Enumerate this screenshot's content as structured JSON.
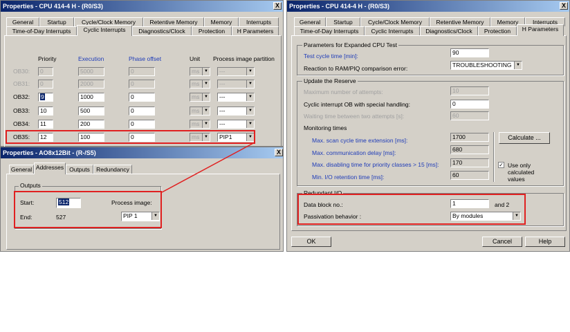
{
  "colors": {
    "highlight": "#e02020",
    "label_blue": "#1f3cb8",
    "titlebar": "#0a246a"
  },
  "left_dialog": {
    "title": "Properties - CPU 414-4 H - (R0/S3)",
    "close": "X",
    "tabs_back": [
      "General",
      "Startup",
      "Cycle/Clock Memory",
      "Retentive Memory",
      "Memory",
      "Interrupts"
    ],
    "tabs_front": [
      "Time-of-Day Interrupts",
      "Cyclic Interrupts",
      "Diagnostics/Clock",
      "Protection",
      "H Parameters"
    ],
    "headers": {
      "priority": "Priority",
      "execution": "Execution",
      "phase": "Phase offset",
      "unit": "Unit",
      "pip": "Process image partition"
    },
    "rows": [
      {
        "ob": "OB30:",
        "priority": "0",
        "execution": "5000",
        "phase": "0",
        "unit": "ms",
        "pip": "---"
      },
      {
        "ob": "OB31:",
        "priority": "0",
        "execution": "2000",
        "phase": "0",
        "unit": "ms",
        "pip": "---"
      },
      {
        "ob": "OB32:",
        "priority": "9",
        "execution": "1000",
        "phase": "0",
        "unit": "ms",
        "pip": "---"
      },
      {
        "ob": "OB33:",
        "priority": "10",
        "execution": "500",
        "phase": "0",
        "unit": "ms",
        "pip": "---"
      },
      {
        "ob": "OB34:",
        "priority": "11",
        "execution": "200",
        "phase": "0",
        "unit": "ms",
        "pip": "---"
      },
      {
        "ob": "OB35:",
        "priority": "12",
        "execution": "100",
        "phase": "0",
        "unit": "ms",
        "pip": "PIP1"
      }
    ]
  },
  "module_dialog": {
    "title": "Properties - AO8x12Bit - (R-/S5)",
    "close": "X",
    "tabs": [
      "General",
      "Addresses",
      "Outputs",
      "Redundancy"
    ],
    "group": "Outputs",
    "start_label": "Start:",
    "start_value": "512",
    "end_label": "End:",
    "end_value": "527",
    "process_image_label": "Process image:",
    "process_image_value": "PIP 1"
  },
  "right_dialog": {
    "title": "Properties - CPU 414-4 H - (R0/S3)",
    "close": "X",
    "tabs_back": [
      "General",
      "Startup",
      "Cycle/Clock Memory",
      "Retentive Memory",
      "Memory",
      "Interrupts"
    ],
    "tabs_front": [
      "Time-of-Day Interrupts",
      "Cyclic Interrupts",
      "Diagnostics/Clock",
      "Protection",
      "H Parameters"
    ],
    "expanded_group": "Parameters for Expanded CPU Test",
    "test_cycle_label": "Test cycle time [min]:",
    "test_cycle_value": "90",
    "reaction_label": "Reaction to RAM/PIQ comparison error:",
    "reaction_value": "TROUBLESHOOTING",
    "reserve_group": "Update the Reserve",
    "max_attempts_label": "Maximum number of attempts:",
    "max_attempts_value": "10",
    "cyclic_ob_label": "Cyclic interrupt OB with special handling:",
    "cyclic_ob_value": "0",
    "waiting_label": "Waiting time between two attempts [s]:",
    "waiting_value": "60",
    "monitoring_label": "Monitoring times",
    "scan_ext_label": "Max. scan cycle time extension [ms]:",
    "scan_ext_value": "1700",
    "comm_delay_label": "Max. communication delay [ms]:",
    "comm_delay_value": "680",
    "disabling_label": "Max. disabling time for priority classes > 15  [ms]:",
    "disabling_value": "170",
    "io_retention_label": "Min. I/O retention time [ms]:",
    "io_retention_value": "60",
    "calculate_button": "Calculate ...",
    "use_only_label_1": "Use only",
    "use_only_label_2": "calculated",
    "use_only_label_3": "values",
    "use_only_checked": "✓",
    "redundant_group": "Redundant I/O",
    "data_block_label": "Data block no.:",
    "data_block_value": "1",
    "and_label": "and  2",
    "passivation_label": "Passivation behavior :",
    "passivation_value": "By modules",
    "ok_button": "OK",
    "cancel_button": "Cancel",
    "help_button": "Help"
  }
}
